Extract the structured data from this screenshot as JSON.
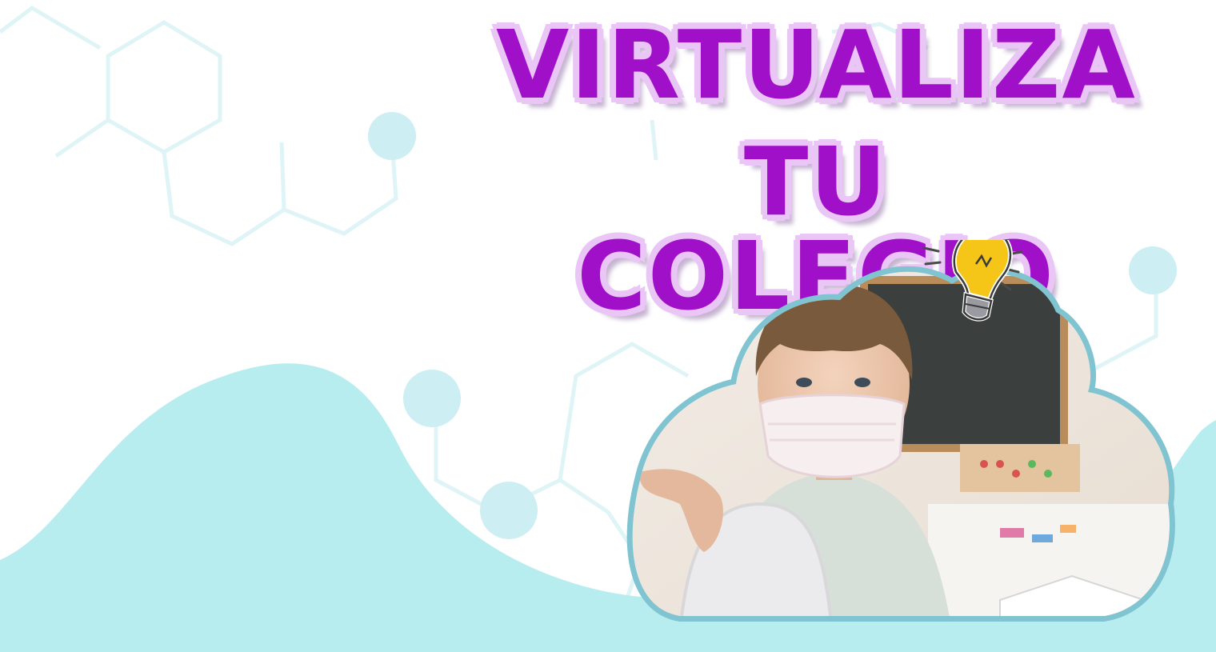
{
  "headline": {
    "line1": "VIRTUALIZA",
    "line2": "TU COLEGIO"
  },
  "colors": {
    "headline_fill": "#a010c8",
    "headline_outline": "#e9c6f5",
    "wave": "#b8edf0",
    "molecule_lines": "#dff4f6",
    "molecule_dots": "#cdeef2",
    "cloud_border": "#7fc4d0"
  },
  "image": {
    "subject": "child wearing a face mask in a classroom",
    "accent_icon": "lightbulb-icon"
  }
}
